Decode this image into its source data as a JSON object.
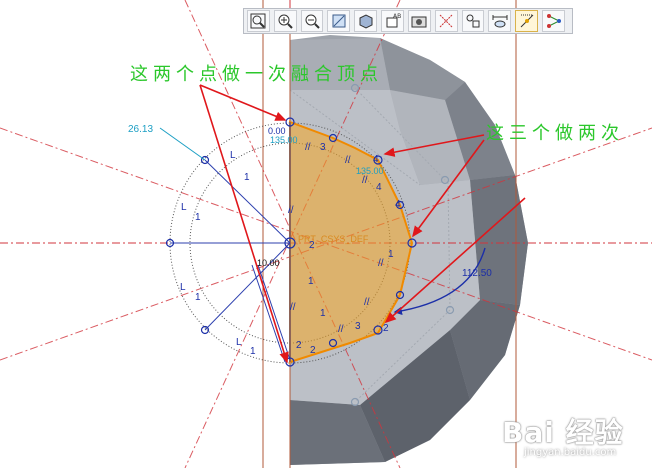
{
  "toolbar": {
    "buttons": [
      {
        "name": "zoom-fit-icon"
      },
      {
        "name": "zoom-in-icon"
      },
      {
        "name": "zoom-out-icon"
      },
      {
        "name": "repaint-icon"
      },
      {
        "name": "display-style-icon"
      },
      {
        "name": "saved-views-icon"
      },
      {
        "name": "camera-icon"
      },
      {
        "name": "datum-display-icon"
      },
      {
        "name": "constraint-display-icon"
      },
      {
        "name": "dimension-display-icon"
      },
      {
        "name": "vertex-display-icon"
      },
      {
        "name": "sketch-tool-icon"
      }
    ]
  },
  "annotations": {
    "top_note": "这两个点做一次融合顶点",
    "right_note": "这三个做两次"
  },
  "sketch": {
    "radius_dim": "26.13",
    "small_dims": [
      "0.00",
      "135.00"
    ],
    "angle_dim_1": "135.00",
    "csys_label": "PRT_CSYS_DEF",
    "length_dim": "10.00",
    "angle_dim_2": "112.50",
    "constraint_L": "L",
    "constraint_1": "1",
    "constraint_2": "2",
    "constraint_3": "3",
    "constraint_4": "4",
    "parallel_mark": "//"
  },
  "watermark": {
    "logo": "Bai 经验",
    "url": "jingyan.baidu.com"
  },
  "colors": {
    "annotation_green": "#2bc72b",
    "arrow_red": "#e0171b",
    "sketch_orange": "#f5a623",
    "dim_blue": "#1c2fa8",
    "dim_cyan": "#1c9fc4",
    "datum_red": "#d2343c",
    "model_gray": "#8b9099"
  }
}
